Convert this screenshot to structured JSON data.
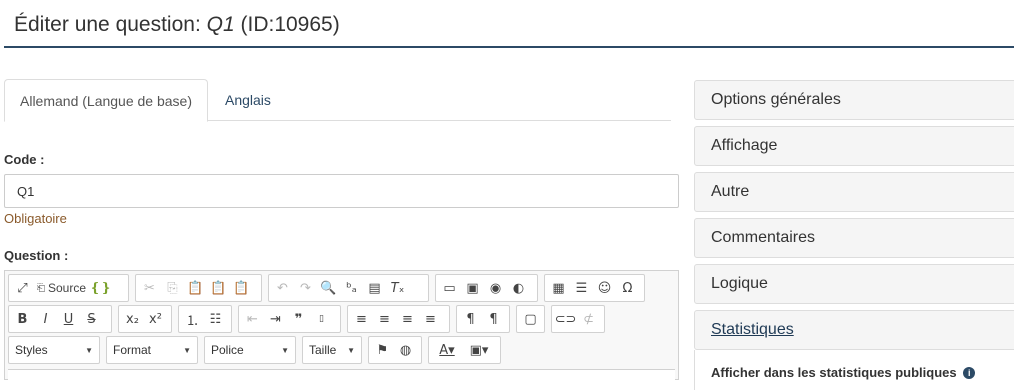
{
  "header": {
    "title_prefix": "Éditer une question:",
    "question_code": "Q1",
    "question_id": "(ID:10965)"
  },
  "tabs": [
    {
      "label": "Allemand (Langue de base)",
      "active": true
    },
    {
      "label": "Anglais",
      "active": false
    }
  ],
  "form": {
    "code_label": "Code :",
    "code_value": "Q1",
    "required_text": "Obligatoire",
    "question_label": "Question :"
  },
  "editor": {
    "source_label": "Source",
    "combos": {
      "styles": "Styles",
      "format": "Format",
      "font": "Police",
      "size": "Taille"
    }
  },
  "panels": [
    {
      "label": "Options générales"
    },
    {
      "label": "Affichage"
    },
    {
      "label": "Autre"
    },
    {
      "label": "Commentaires"
    },
    {
      "label": "Logique"
    },
    {
      "label": "Statistiques"
    }
  ],
  "statistics": {
    "option_label": "Afficher dans les statistiques publiques"
  },
  "colors": {
    "accent": "#2c4a66",
    "required": "#8a5a2b"
  }
}
